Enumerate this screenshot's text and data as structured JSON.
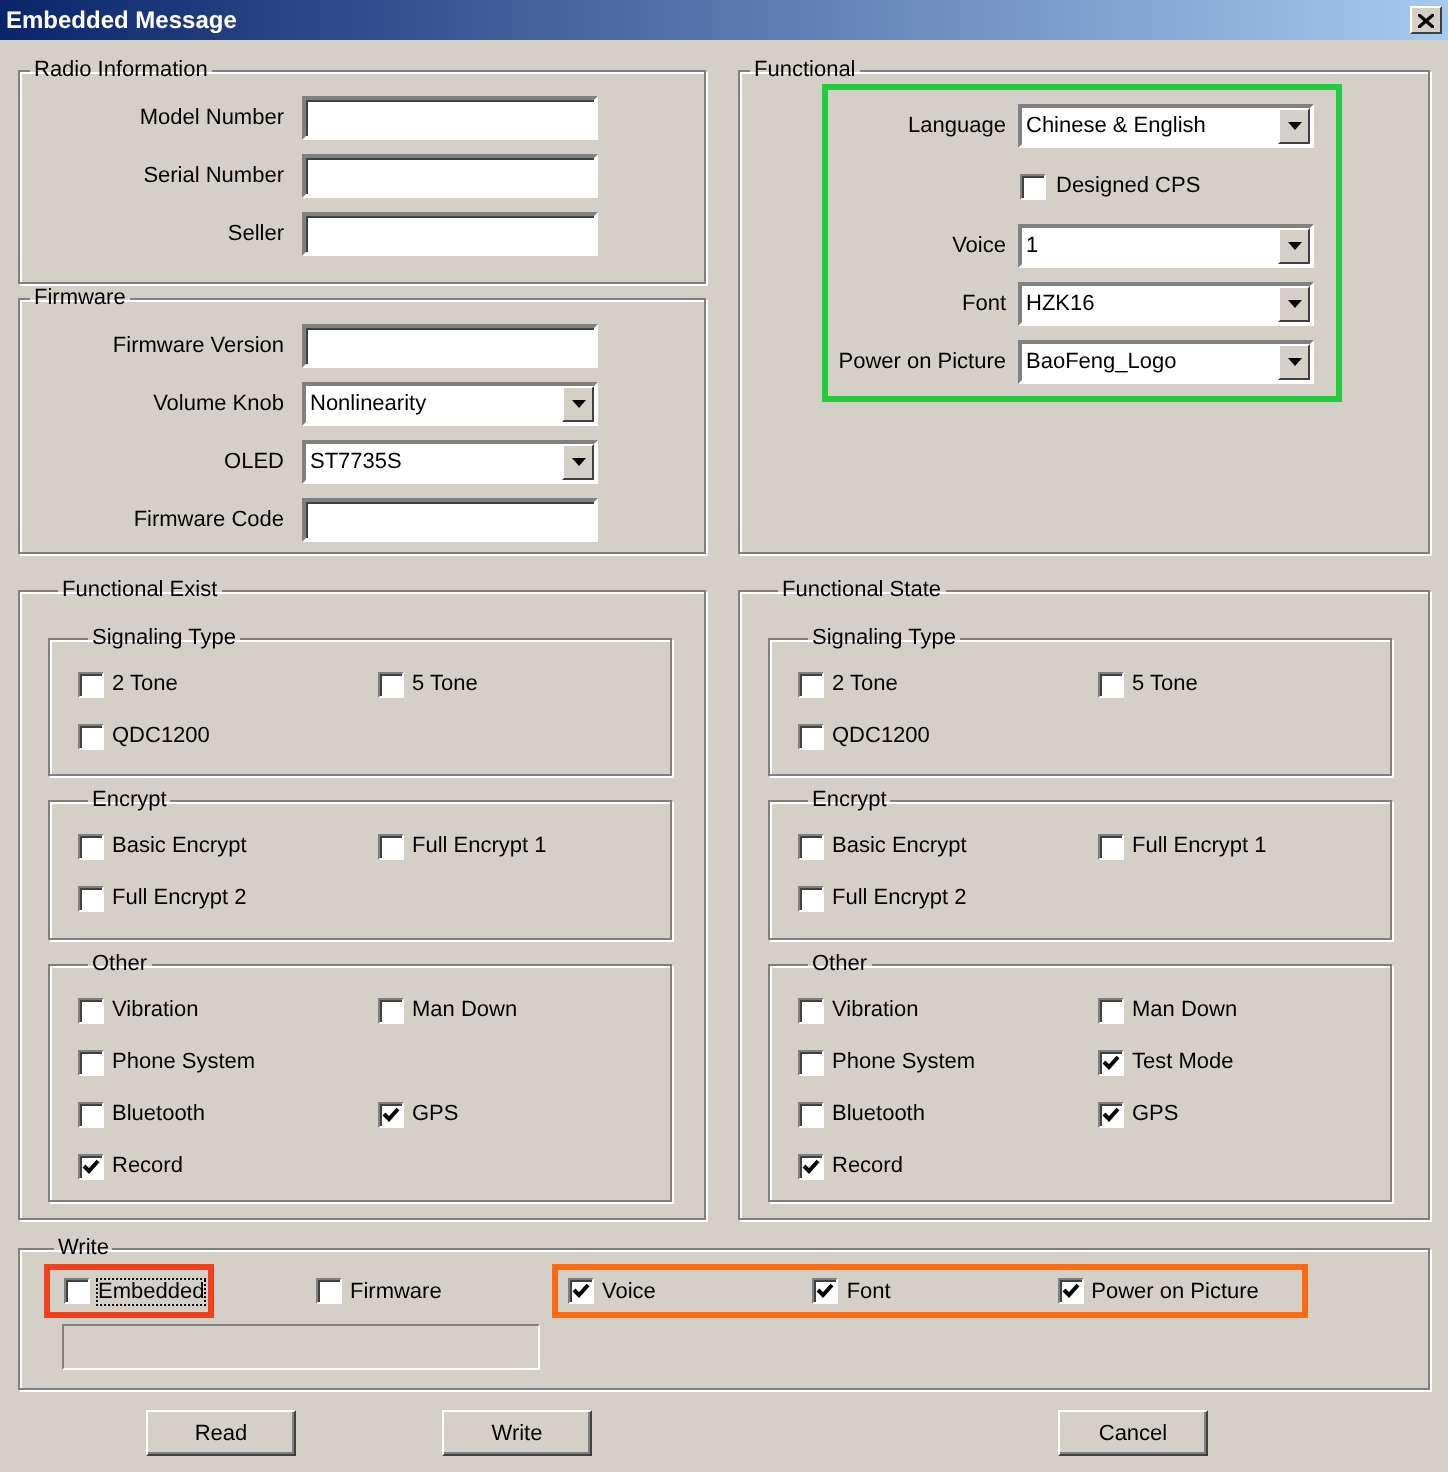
{
  "window": {
    "title": "Embedded Message"
  },
  "radio_information": {
    "title": "Radio Information",
    "fields": [
      {
        "label": "Model Number",
        "kind": "text"
      },
      {
        "label": "Serial Number",
        "kind": "text"
      },
      {
        "label": "Seller",
        "kind": "text"
      }
    ]
  },
  "firmware": {
    "title": "Firmware",
    "fields": [
      {
        "label": "Firmware Version",
        "kind": "text"
      },
      {
        "label": "Volume Knob",
        "kind": "dropdown",
        "value": "Nonlinearity"
      },
      {
        "label": "OLED",
        "kind": "dropdown",
        "value": "ST7735S"
      },
      {
        "label": "Firmware Code",
        "kind": "text"
      }
    ]
  },
  "functional": {
    "title": "Functional",
    "fields": [
      {
        "label": "Language",
        "kind": "dropdown",
        "value": "Chinese & English"
      },
      {
        "label": "Designed CPS",
        "kind": "checkbox",
        "checked": false
      },
      {
        "label": "Voice",
        "kind": "dropdown",
        "value": "1"
      },
      {
        "label": "Font",
        "kind": "dropdown",
        "value": "HZK16"
      },
      {
        "label": "Power on Picture",
        "kind": "dropdown",
        "value": "BaoFeng_Logo"
      }
    ]
  },
  "functional_exist": {
    "title": "Functional Exist",
    "groups": [
      {
        "title": "Signaling Type",
        "rows": [
          [
            {
              "label": "2 Tone",
              "checked": false
            },
            {
              "label": "5 Tone",
              "checked": false
            }
          ],
          [
            {
              "label": "QDC1200",
              "checked": false
            }
          ]
        ]
      },
      {
        "title": "Encrypt",
        "rows": [
          [
            {
              "label": "Basic Encrypt",
              "checked": false
            },
            {
              "label": "Full Encrypt 1",
              "checked": false
            }
          ],
          [
            {
              "label": "Full Encrypt 2",
              "checked": false
            }
          ]
        ]
      },
      {
        "title": "Other",
        "rows": [
          [
            {
              "label": "Vibration",
              "checked": false
            },
            {
              "label": "Man Down",
              "checked": false
            }
          ],
          [
            {
              "label": "Phone System",
              "checked": false
            }
          ],
          [
            {
              "label": "Bluetooth",
              "checked": false
            },
            {
              "label": "GPS",
              "checked": true
            }
          ],
          [
            {
              "label": "Record",
              "checked": true
            }
          ]
        ]
      }
    ]
  },
  "functional_state": {
    "title": "Functional State",
    "groups": [
      {
        "title": "Signaling Type",
        "rows": [
          [
            {
              "label": "2 Tone",
              "checked": false
            },
            {
              "label": "5 Tone",
              "checked": false
            }
          ],
          [
            {
              "label": "QDC1200",
              "checked": false
            }
          ]
        ]
      },
      {
        "title": "Encrypt",
        "rows": [
          [
            {
              "label": "Basic Encrypt",
              "checked": false
            },
            {
              "label": "Full Encrypt 1",
              "checked": false
            }
          ],
          [
            {
              "label": "Full Encrypt 2",
              "checked": false
            }
          ]
        ]
      },
      {
        "title": "Other",
        "rows": [
          [
            {
              "label": "Vibration",
              "checked": false
            },
            {
              "label": "Man Down",
              "checked": false
            }
          ],
          [
            {
              "label": "Phone System",
              "checked": false
            },
            {
              "label": "Test Mode",
              "checked": true
            }
          ],
          [
            {
              "label": "Bluetooth",
              "checked": false
            },
            {
              "label": "GPS",
              "checked": true
            }
          ],
          [
            {
              "label": "Record",
              "checked": true
            }
          ]
        ]
      }
    ]
  },
  "write": {
    "title": "Write",
    "option_groups": [
      {
        "color": "#f0401c",
        "options": [
          {
            "label": "Embedded",
            "checked": false,
            "focused": true
          }
        ]
      },
      {
        "options": [
          {
            "label": "Firmware",
            "checked": false,
            "focused": false
          }
        ]
      },
      {
        "color": "#ff6a10",
        "options": [
          {
            "label": "Voice",
            "checked": true,
            "focused": false
          },
          {
            "label": "Font",
            "checked": true,
            "focused": false
          },
          {
            "label": "Power on Picture",
            "checked": true,
            "focused": false
          }
        ]
      }
    ],
    "progress": {
      "level": 0
    }
  },
  "buttons": [
    {
      "label": "Read"
    },
    {
      "label": "Write"
    },
    {
      "label": "Cancel"
    }
  ]
}
